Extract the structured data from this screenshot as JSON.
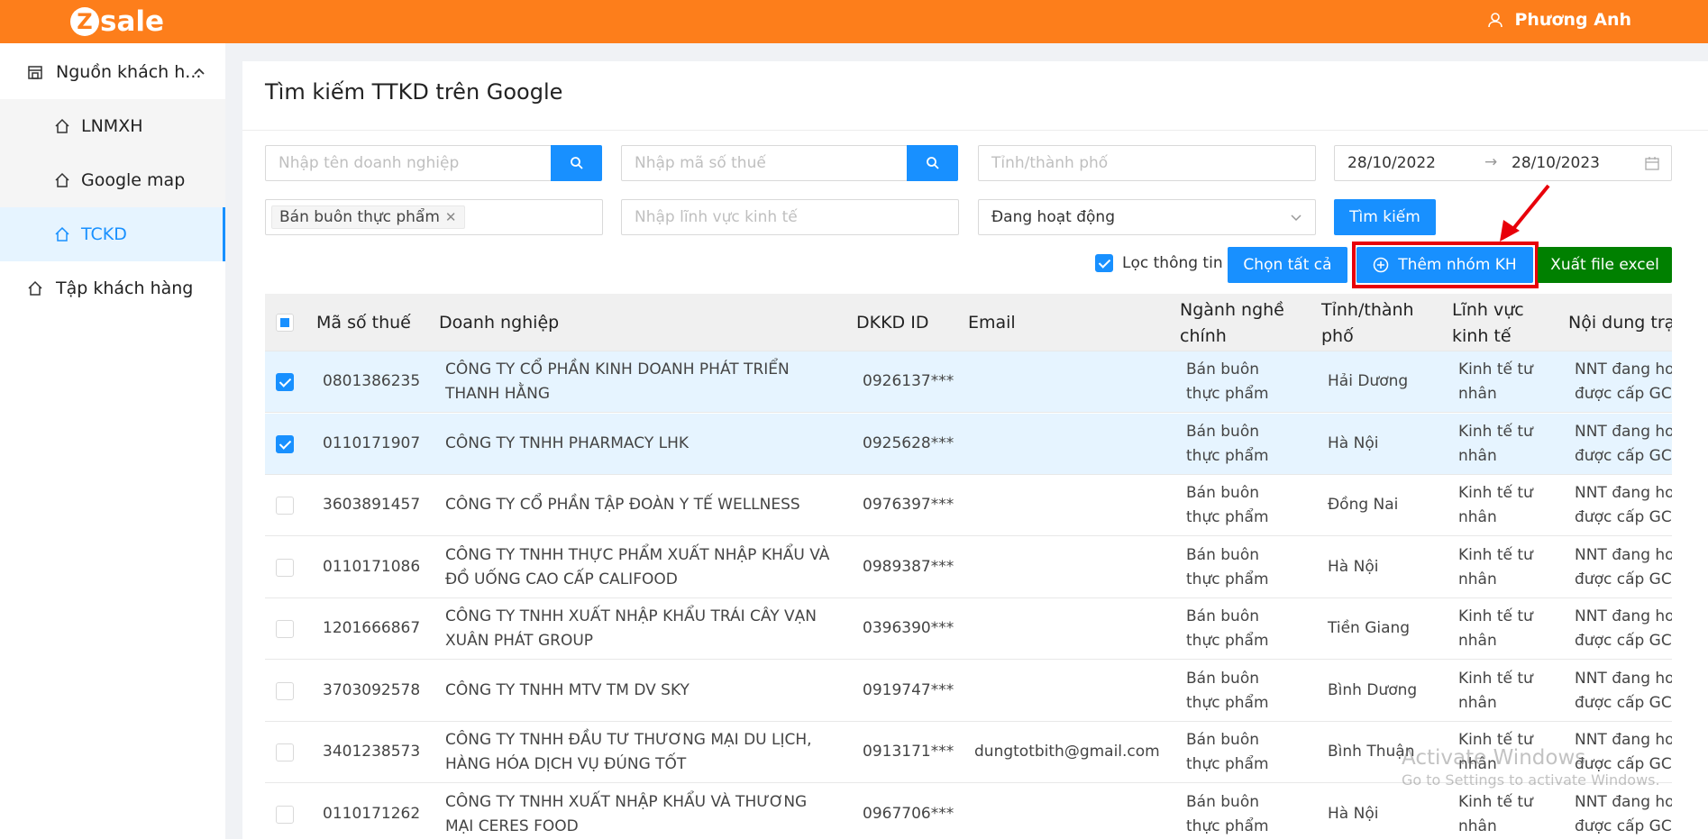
{
  "header": {
    "logo_letter": "Z",
    "logo_text": "sale",
    "user_name": "Phương Anh"
  },
  "sidebar": {
    "items": [
      {
        "label": "Nguồn khách h...",
        "icon": "store-icon"
      },
      {
        "label": "LNMXH",
        "icon": "home-icon"
      },
      {
        "label": "Google map",
        "icon": "home-icon"
      },
      {
        "label": "TCKD",
        "icon": "home-icon",
        "active": true
      },
      {
        "label": "Tập khách hàng",
        "icon": "home-icon"
      }
    ]
  },
  "page": {
    "title": "Tìm kiếm TTKD trên Google"
  },
  "filters": {
    "company_placeholder": "Nhập tên doanh nghiệp",
    "tax_placeholder": "Nhập mã số thuế",
    "province_placeholder": "Tỉnh/thành phố",
    "date_from": "28/10/2022",
    "date_to": "28/10/2023",
    "industry_tag": "Bán buôn thực phẩm",
    "sector_placeholder": "Nhập lĩnh vực kinh tế",
    "status_value": "Đang hoạt động",
    "search_button": "Tìm kiếm"
  },
  "actions": {
    "filter_info": "Lọc thông tin",
    "select_all": "Chọn tất cả",
    "add_group": "Thêm nhóm KH",
    "export_excel": "Xuất file excel"
  },
  "table": {
    "headers": {
      "tax": "Mã số thuế",
      "company": "Doanh nghiệp",
      "dkkd": "DKKD ID",
      "email": "Email",
      "industry_1": "Ngành nghề",
      "industry_2": "chính",
      "province_1": "Tỉnh/thành",
      "province_2": "phố",
      "sector_1": "Lĩnh vực",
      "sector_2": "kinh tế",
      "content": "Nội dung trạ"
    },
    "rows": [
      {
        "checked": true,
        "tax": "0801386235",
        "company_1": "CÔNG TY CỔ PHẦN KINH DOANH PHÁT TRIỂN",
        "company_2": "THANH HẰNG",
        "dkkd": "0926137***",
        "email": "",
        "industry_1": "Bán buôn",
        "industry_2": "thực phẩm",
        "province": "Hải Dương",
        "sector_1": "Kinh tế tư",
        "sector_2": "nhân",
        "content_1": "NNT đang hoạ",
        "content_2": "được cấp GCN"
      },
      {
        "checked": true,
        "tax": "0110171907",
        "company_1": "CÔNG TY TNHH PHARMACY LHK",
        "company_2": "",
        "dkkd": "0925628***",
        "email": "",
        "industry_1": "Bán buôn",
        "industry_2": "thực phẩm",
        "province": "Hà Nội",
        "sector_1": "Kinh tế tư",
        "sector_2": "nhân",
        "content_1": "NNT đang hoạ",
        "content_2": "được cấp GCN"
      },
      {
        "checked": false,
        "tax": "3603891457",
        "company_1": "CÔNG TY CỔ PHẦN TẬP ĐOÀN Y TẾ WELLNESS",
        "company_2": "",
        "dkkd": "0976397***",
        "email": "",
        "industry_1": "Bán buôn",
        "industry_2": "thực phẩm",
        "province": "Đồng Nai",
        "sector_1": "Kinh tế tư",
        "sector_2": "nhân",
        "content_1": "NNT đang hoạ",
        "content_2": "được cấp GCN"
      },
      {
        "checked": false,
        "tax": "0110171086",
        "company_1": "CÔNG TY TNHH THỰC PHẨM XUẤT NHẬP KHẨU VÀ",
        "company_2": "ĐỒ UỐNG CAO CẤP CALIFOOD",
        "dkkd": "0989387***",
        "email": "",
        "industry_1": "Bán buôn",
        "industry_2": "thực phẩm",
        "province": "Hà Nội",
        "sector_1": "Kinh tế tư",
        "sector_2": "nhân",
        "content_1": "NNT đang hoạ",
        "content_2": "được cấp GCN"
      },
      {
        "checked": false,
        "tax": "1201666867",
        "company_1": "CÔNG TY TNHH XUẤT NHẬP KHẨU TRÁI CÂY VẠN",
        "company_2": "XUÂN PHÁT GROUP",
        "dkkd": "0396390***",
        "email": "",
        "industry_1": "Bán buôn",
        "industry_2": "thực phẩm",
        "province": "Tiền Giang",
        "sector_1": "Kinh tế tư",
        "sector_2": "nhân",
        "content_1": "NNT đang hoạ",
        "content_2": "được cấp GCN"
      },
      {
        "checked": false,
        "tax": "3703092578",
        "company_1": "CÔNG TY TNHH MTV TM DV SKY",
        "company_2": "",
        "dkkd": "0919747***",
        "email": "",
        "industry_1": "Bán buôn",
        "industry_2": "thực phẩm",
        "province": "Bình Dương",
        "sector_1": "Kinh tế tư",
        "sector_2": "nhân",
        "content_1": "NNT đang hoạ",
        "content_2": "được cấp GCN"
      },
      {
        "checked": false,
        "tax": "3401238573",
        "company_1": "CÔNG TY TNHH ĐẦU TƯ THƯƠNG MẠI DU LỊCH,",
        "company_2": "HÀNG HÓA DỊCH VỤ ĐÚNG TỐT",
        "dkkd": "0913171***",
        "email": "dungtotbith@gmail.com",
        "industry_1": "Bán buôn",
        "industry_2": "thực phẩm",
        "province": "Bình Thuận",
        "sector_1": "Kinh tế tư",
        "sector_2": "nhân",
        "content_1": "NNT đang hoạ",
        "content_2": "được cấp GCN"
      },
      {
        "checked": false,
        "tax": "0110171262",
        "company_1": "CÔNG TY TNHH XUẤT NHẬP KHẨU VÀ THƯƠNG",
        "company_2": "MẠI CERES FOOD",
        "dkkd": "0967706***",
        "email": "",
        "industry_1": "Bán buôn",
        "industry_2": "thực phẩm",
        "province": "Hà Nội",
        "sector_1": "Kinh tế tư",
        "sector_2": "nhân",
        "content_1": "NNT đang hoạ",
        "content_2": "được cấp GCN"
      }
    ]
  },
  "watermark": {
    "line1": "Activate Windows",
    "line2": "Go to Settings to activate Windows."
  },
  "colors": {
    "brand": "#fd7e1b",
    "primary": "#1890ff",
    "export": "#008000",
    "highlight": "#e8000a"
  }
}
